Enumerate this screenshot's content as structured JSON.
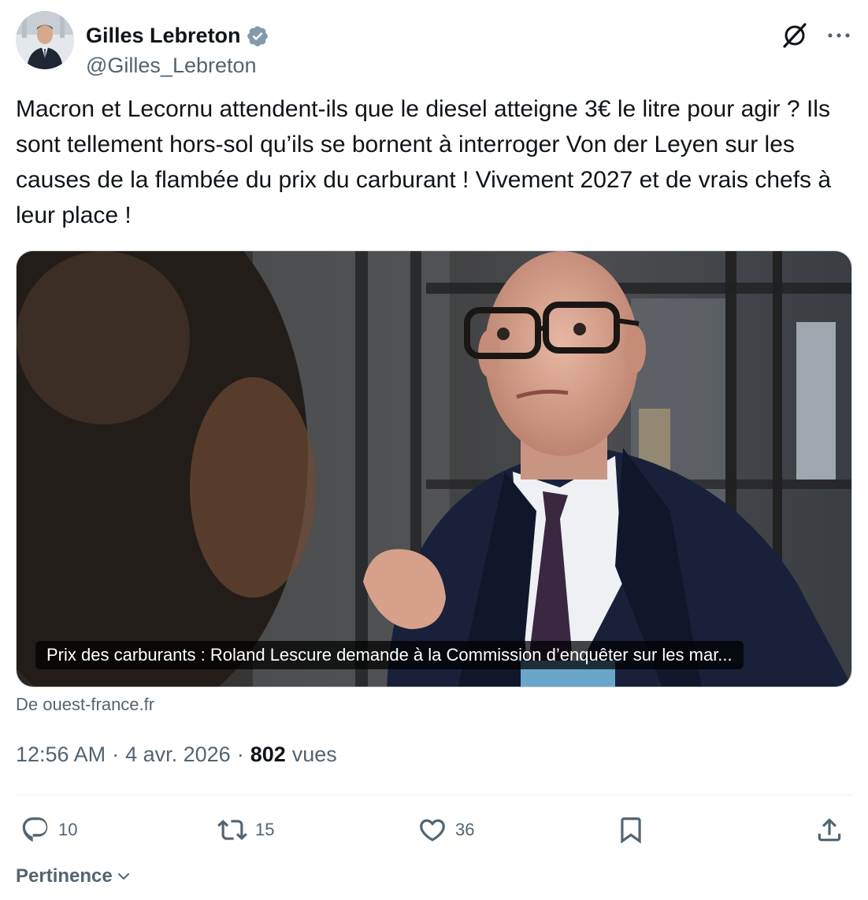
{
  "author": {
    "display_name": "Gilles Lebreton",
    "handle": "@Gilles_Lebreton",
    "verified_badge_color": "#829aab"
  },
  "header_icons": [
    "grok-icon",
    "more-options-icon"
  ],
  "tweet": {
    "text": "Macron et Lecornu attendent-ils que le diesel atteigne 3€ le litre pour agir ? Ils sont tellement hors-sol qu’ils se bornent à interroger Von der Leyen sur les causes de la flambée du prix du carburant ! Vivement 2027 et de vrais chefs à leur place !"
  },
  "link_card": {
    "caption": "Prix des carburants : Roland Lescure demande à la Commission d’enquêter sur les mar...",
    "source_prefix": "De",
    "source_domain": "ouest-france.fr"
  },
  "meta": {
    "time": "12:56 AM",
    "date": "4 avr. 2026",
    "views_count": "802",
    "views_label": "vues",
    "separator": "·"
  },
  "actions": {
    "replies": "10",
    "reposts": "15",
    "likes": "36"
  },
  "sort": {
    "label": "Pertinence"
  },
  "colors": {
    "text_primary": "#0f1419",
    "text_secondary": "#536471",
    "divider": "#eff3f4"
  }
}
